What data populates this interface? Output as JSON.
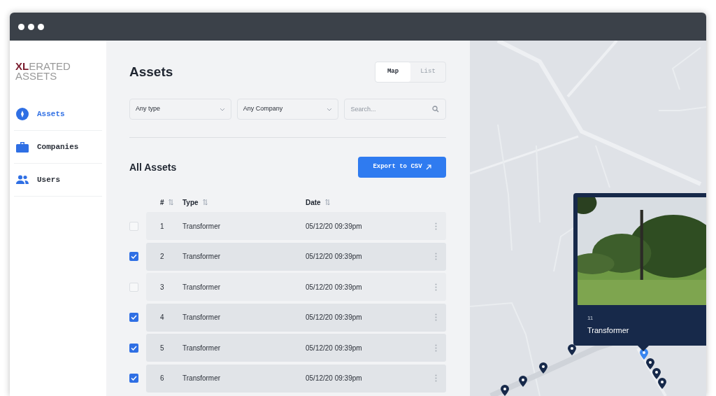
{
  "logo": {
    "accent": "XL",
    "rest": "ERATED",
    "line2": "ASSETS"
  },
  "sidebar": {
    "items": [
      {
        "label": "Assets",
        "selected": true
      },
      {
        "label": "Companies",
        "selected": false
      },
      {
        "label": "Users",
        "selected": false
      }
    ]
  },
  "page": {
    "title": "Assets",
    "view_toggle": [
      {
        "label": "Map",
        "selected": true
      },
      {
        "label": "List",
        "selected": false
      }
    ]
  },
  "filters": [
    {
      "kind": "select",
      "value": "Any type"
    },
    {
      "kind": "select",
      "value": "Any Company"
    },
    {
      "kind": "search",
      "placeholder": "Search..."
    }
  ],
  "section": {
    "title": "All Assets",
    "export_button": "Export to CSV"
  },
  "table": {
    "columns": [
      "#",
      "Type",
      "Date"
    ],
    "rows": [
      {
        "checked": false,
        "cells": [
          "1",
          "Transformer",
          "05/12/20 09:39pm"
        ]
      },
      {
        "checked": true,
        "cells": [
          "2",
          "Transformer",
          "05/12/20 09:39pm"
        ]
      },
      {
        "checked": false,
        "cells": [
          "3",
          "Transformer",
          "05/12/20 09:39pm"
        ]
      },
      {
        "checked": true,
        "cells": [
          "4",
          "Transformer",
          "05/12/20 09:39pm"
        ]
      },
      {
        "checked": true,
        "cells": [
          "5",
          "Transformer",
          "05/12/20 09:39pm"
        ]
      },
      {
        "checked": true,
        "cells": [
          "6",
          "Transformer",
          "05/12/20 09:39pm"
        ]
      }
    ]
  },
  "map": {
    "popup": {
      "number": "11",
      "title": "Transformer"
    },
    "pins": [
      {
        "selected": true
      },
      {
        "selected": false
      },
      {
        "selected": false
      },
      {
        "selected": false
      },
      {
        "selected": false
      },
      {
        "selected": false
      },
      {
        "selected": false
      },
      {
        "selected": false
      }
    ]
  }
}
